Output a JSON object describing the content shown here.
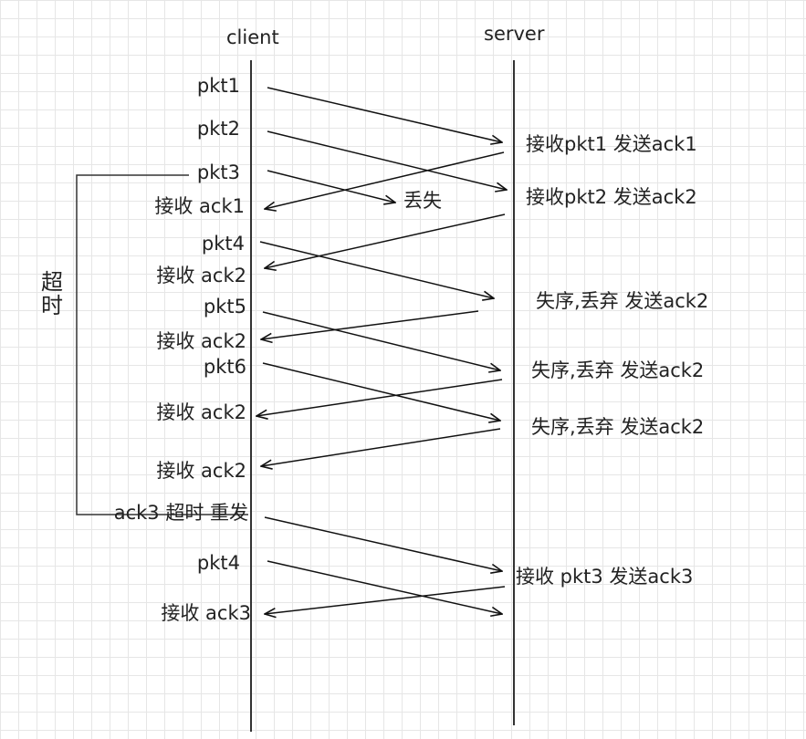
{
  "headers": {
    "client": "client",
    "server": "server"
  },
  "timeout_label": "超时",
  "client_labels": {
    "pkt1": "pkt1",
    "pkt2": "pkt2",
    "pkt3": "pkt3",
    "recv_ack1": "接收 ack1",
    "pkt4": "pkt4",
    "recv_ack2_a": "接收 ack2",
    "pkt5": "pkt5",
    "recv_ack2_b": "接收 ack2",
    "pkt6": "pkt6",
    "recv_ack2_c": "接收 ack2",
    "recv_ack2_d": "接收 ack2",
    "resend": "ack3 超时 重发",
    "pkt4_resend": "pkt4",
    "recv_ack3": "接收 ack3"
  },
  "lost_label": "丢失",
  "server_labels": {
    "s1": "接收pkt1 发送ack1",
    "s2": "接收pkt2 发送ack2",
    "s3": "失序,丢弃 发送ack2",
    "s4": "失序,丢弃 发送ack2",
    "s5": "失序,丢弃 发送ack2",
    "s6": "接收 pkt3 发送ack3"
  }
}
